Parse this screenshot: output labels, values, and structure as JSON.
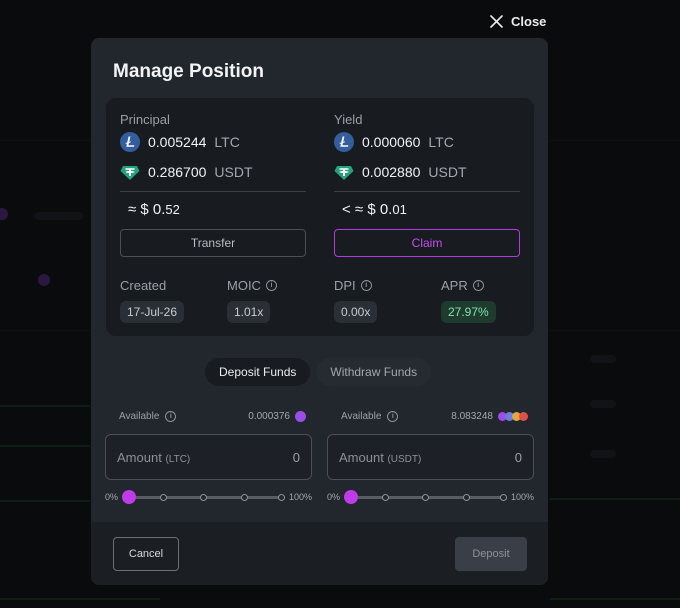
{
  "close": {
    "label": "Close"
  },
  "modal": {
    "title": "Manage Position"
  },
  "principal": {
    "label": "Principal",
    "ltc": {
      "amount": "0.005244",
      "symbol": "LTC"
    },
    "usdt": {
      "amount": "0.286700",
      "symbol": "USDT"
    },
    "approx_prefix": "≈ $ 0.",
    "approx_small": "52",
    "button": "Transfer"
  },
  "yield": {
    "label": "Yield",
    "ltc": {
      "amount": "0.000060",
      "symbol": "LTC"
    },
    "usdt": {
      "amount": "0.002880",
      "symbol": "USDT"
    },
    "approx_prefix": "< ≈ $ 0.",
    "approx_small": "01",
    "button": "Claim"
  },
  "stats": {
    "created": {
      "label": "Created",
      "value": "17-Jul-26"
    },
    "moic": {
      "label": "MOIC",
      "value": "1.01x"
    },
    "dpi": {
      "label": "DPI",
      "value": "0.00x"
    },
    "apr": {
      "label": "APR",
      "value": "27.97%"
    }
  },
  "tabs": [
    {
      "label": "Deposit Funds",
      "active": true
    },
    {
      "label": "Withdraw Funds",
      "active": false
    }
  ],
  "funds": {
    "left": {
      "available_label": "Available",
      "available_value": "0.000376",
      "amount_label": "Amount",
      "amount_unit": "(LTC)",
      "amount_value": "0",
      "slider_min": "0%",
      "slider_max": "100%",
      "slider_value": 0
    },
    "right": {
      "available_label": "Available",
      "available_value": "8.083248",
      "amount_label": "Amount",
      "amount_unit": "(USDT)",
      "amount_value": "0",
      "slider_min": "0%",
      "slider_max": "100%",
      "slider_value": 0
    }
  },
  "footer": {
    "cancel": "Cancel",
    "deposit": "Deposit"
  },
  "colors": {
    "accent": "#c03be8",
    "ltc": "#345d9d",
    "usdt": "#26a17b",
    "apr_green": "#7de3b0"
  }
}
